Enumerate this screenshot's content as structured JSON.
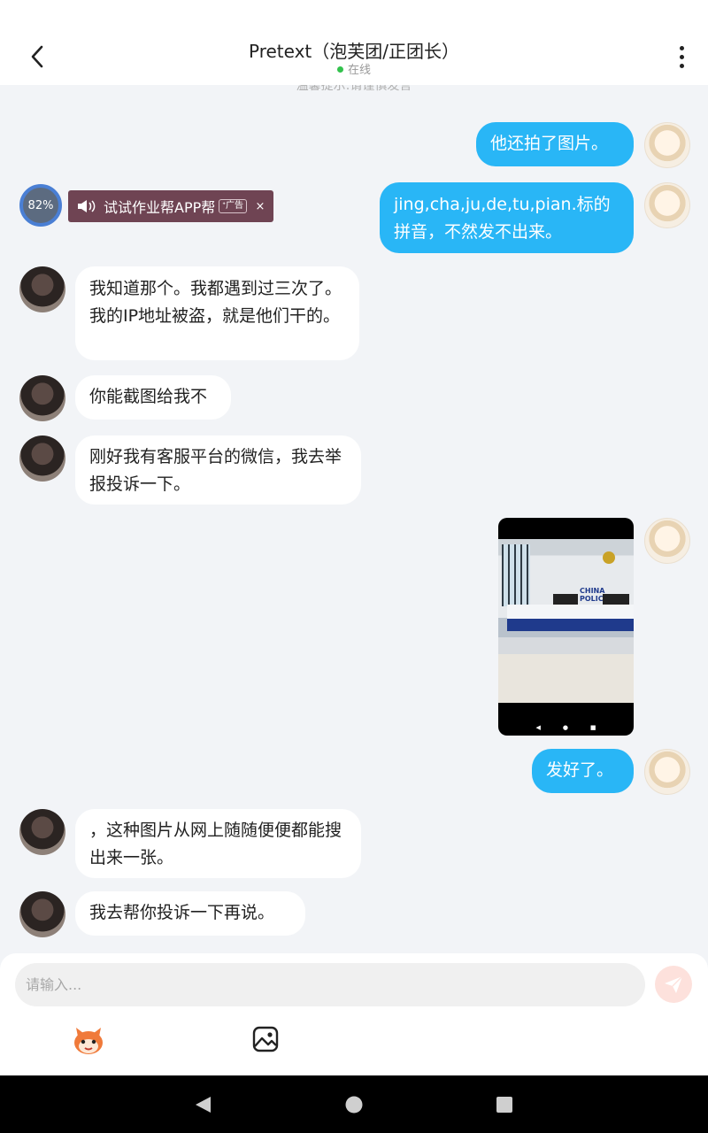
{
  "header": {
    "title": "Pretext（泡芙团/正团长）",
    "status": "在线",
    "status_color": "#33c24d",
    "back_icon": "chevron-left-icon",
    "more_icon": "more-vertical-icon"
  },
  "notice": "温馨提示:请谨慎发言",
  "ad": {
    "progress_text": "82%",
    "text": "试试作业帮APP帮",
    "tag": "广告",
    "close": "×"
  },
  "messages": [
    {
      "from": "me",
      "text": "他还拍了图片。"
    },
    {
      "from": "me",
      "text": "jing,cha,ju,de,tu,pian.标的拼音，不然发不出来。"
    },
    {
      "from": "other",
      "text": " 我知道那个。我都遇到过三次了。我的IP地址被盗，就是他们干的。"
    },
    {
      "from": "other",
      "text": "你能截图给我不"
    },
    {
      "from": "other",
      "text": "刚好我有客服平台的微信，我去举报投诉一下。"
    },
    {
      "from": "me",
      "type": "image",
      "image_caption": "CHINA POLICE"
    },
    {
      "from": "me",
      "text": "发好了。"
    },
    {
      "from": "other",
      "text": "，这种图片从网上随随便便都能搜出来一张。"
    },
    {
      "from": "other",
      "text": "我去帮你投诉一下再说。"
    }
  ],
  "composer": {
    "placeholder": "请输入...",
    "send_icon": "send-icon",
    "send_color": "#fde1dc",
    "emoji_icon": "emoji-face-icon",
    "image_icon": "image-icon"
  },
  "colors": {
    "my_bubble": "#29b6f6",
    "other_bubble": "#ffffff",
    "background": "#f2f4f7"
  }
}
